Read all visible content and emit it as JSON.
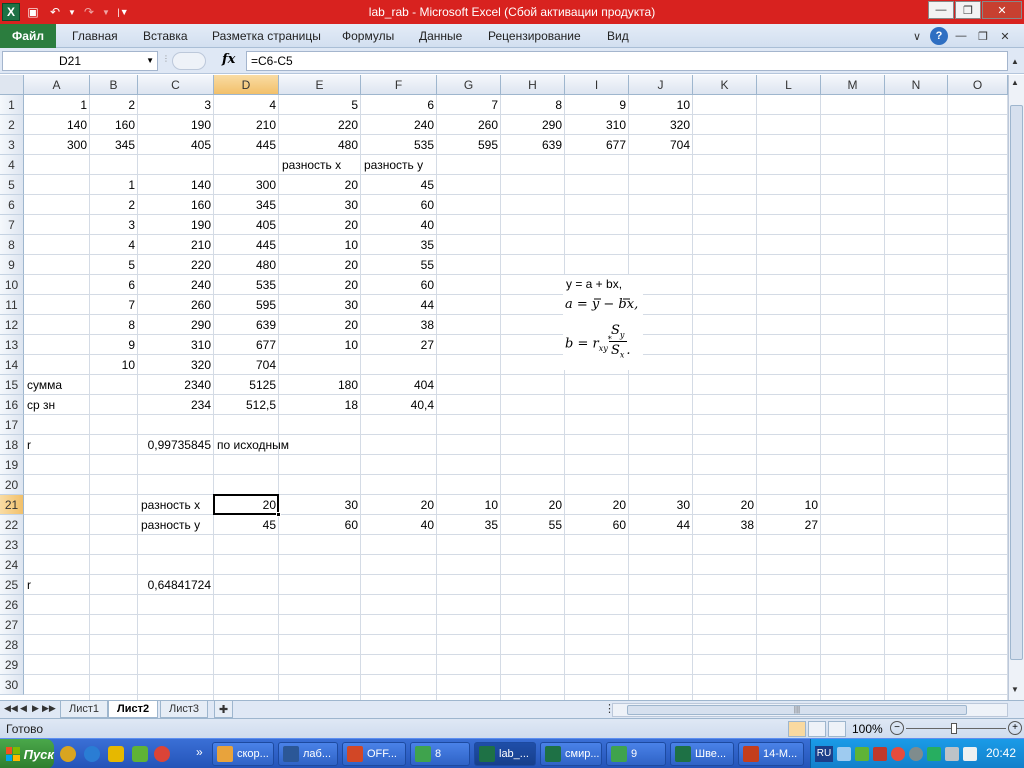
{
  "window": {
    "title": "lab_rab  -  Microsoft Excel (Сбой активации продукта)"
  },
  "ribbon": {
    "file_tab": "Файл",
    "tabs": [
      "Главная",
      "Вставка",
      "Разметка страницы",
      "Формулы",
      "Данные",
      "Рецензирование",
      "Вид"
    ]
  },
  "formula_bar": {
    "name_box": "D21",
    "fx": "fx",
    "formula": "=C6-C5"
  },
  "grid": {
    "columns": [
      "A",
      "B",
      "C",
      "D",
      "E",
      "F",
      "G",
      "H",
      "I",
      "J",
      "K",
      "L",
      "M",
      "N",
      "O"
    ],
    "rows": [
      "1",
      "2",
      "3",
      "4",
      "5",
      "6",
      "7",
      "8",
      "9",
      "10",
      "11",
      "12",
      "13",
      "14",
      "15",
      "16",
      "17",
      "18",
      "19",
      "20",
      "21",
      "22",
      "23",
      "24",
      "25",
      "26",
      "27",
      "28",
      "29",
      "30"
    ],
    "selected_column": "D",
    "selected_row": "21",
    "cells": [
      {
        "ref": "A1",
        "v": "1",
        "t": "n"
      },
      {
        "ref": "B1",
        "v": "2",
        "t": "n"
      },
      {
        "ref": "C1",
        "v": "3",
        "t": "n"
      },
      {
        "ref": "D1",
        "v": "4",
        "t": "n"
      },
      {
        "ref": "E1",
        "v": "5",
        "t": "n"
      },
      {
        "ref": "F1",
        "v": "6",
        "t": "n"
      },
      {
        "ref": "G1",
        "v": "7",
        "t": "n"
      },
      {
        "ref": "H1",
        "v": "8",
        "t": "n"
      },
      {
        "ref": "I1",
        "v": "9",
        "t": "n"
      },
      {
        "ref": "J1",
        "v": "10",
        "t": "n"
      },
      {
        "ref": "A2",
        "v": "140",
        "t": "n"
      },
      {
        "ref": "B2",
        "v": "160",
        "t": "n"
      },
      {
        "ref": "C2",
        "v": "190",
        "t": "n"
      },
      {
        "ref": "D2",
        "v": "210",
        "t": "n"
      },
      {
        "ref": "E2",
        "v": "220",
        "t": "n"
      },
      {
        "ref": "F2",
        "v": "240",
        "t": "n"
      },
      {
        "ref": "G2",
        "v": "260",
        "t": "n"
      },
      {
        "ref": "H2",
        "v": "290",
        "t": "n"
      },
      {
        "ref": "I2",
        "v": "310",
        "t": "n"
      },
      {
        "ref": "J2",
        "v": "320",
        "t": "n"
      },
      {
        "ref": "A3",
        "v": "300",
        "t": "n"
      },
      {
        "ref": "B3",
        "v": "345",
        "t": "n"
      },
      {
        "ref": "C3",
        "v": "405",
        "t": "n"
      },
      {
        "ref": "D3",
        "v": "445",
        "t": "n"
      },
      {
        "ref": "E3",
        "v": "480",
        "t": "n"
      },
      {
        "ref": "F3",
        "v": "535",
        "t": "n"
      },
      {
        "ref": "G3",
        "v": "595",
        "t": "n"
      },
      {
        "ref": "H3",
        "v": "639",
        "t": "n"
      },
      {
        "ref": "I3",
        "v": "677",
        "t": "n"
      },
      {
        "ref": "J3",
        "v": "704",
        "t": "n"
      },
      {
        "ref": "E4",
        "v": "разность x",
        "t": "s"
      },
      {
        "ref": "F4",
        "v": "разность y",
        "t": "s"
      },
      {
        "ref": "B5",
        "v": "1",
        "t": "n"
      },
      {
        "ref": "C5",
        "v": "140",
        "t": "n"
      },
      {
        "ref": "D5",
        "v": "300",
        "t": "n"
      },
      {
        "ref": "E5",
        "v": "20",
        "t": "n"
      },
      {
        "ref": "F5",
        "v": "45",
        "t": "n"
      },
      {
        "ref": "B6",
        "v": "2",
        "t": "n"
      },
      {
        "ref": "C6",
        "v": "160",
        "t": "n"
      },
      {
        "ref": "D6",
        "v": "345",
        "t": "n"
      },
      {
        "ref": "E6",
        "v": "30",
        "t": "n"
      },
      {
        "ref": "F6",
        "v": "60",
        "t": "n"
      },
      {
        "ref": "B7",
        "v": "3",
        "t": "n"
      },
      {
        "ref": "C7",
        "v": "190",
        "t": "n"
      },
      {
        "ref": "D7",
        "v": "405",
        "t": "n"
      },
      {
        "ref": "E7",
        "v": "20",
        "t": "n"
      },
      {
        "ref": "F7",
        "v": "40",
        "t": "n"
      },
      {
        "ref": "B8",
        "v": "4",
        "t": "n"
      },
      {
        "ref": "C8",
        "v": "210",
        "t": "n"
      },
      {
        "ref": "D8",
        "v": "445",
        "t": "n"
      },
      {
        "ref": "E8",
        "v": "10",
        "t": "n"
      },
      {
        "ref": "F8",
        "v": "35",
        "t": "n"
      },
      {
        "ref": "B9",
        "v": "5",
        "t": "n"
      },
      {
        "ref": "C9",
        "v": "220",
        "t": "n"
      },
      {
        "ref": "D9",
        "v": "480",
        "t": "n"
      },
      {
        "ref": "E9",
        "v": "20",
        "t": "n"
      },
      {
        "ref": "F9",
        "v": "55",
        "t": "n"
      },
      {
        "ref": "B10",
        "v": "6",
        "t": "n"
      },
      {
        "ref": "C10",
        "v": "240",
        "t": "n"
      },
      {
        "ref": "D10",
        "v": "535",
        "t": "n"
      },
      {
        "ref": "E10",
        "v": "20",
        "t": "n"
      },
      {
        "ref": "F10",
        "v": "60",
        "t": "n"
      },
      {
        "ref": "B11",
        "v": "7",
        "t": "n"
      },
      {
        "ref": "C11",
        "v": "260",
        "t": "n"
      },
      {
        "ref": "D11",
        "v": "595",
        "t": "n"
      },
      {
        "ref": "E11",
        "v": "30",
        "t": "n"
      },
      {
        "ref": "F11",
        "v": "44",
        "t": "n"
      },
      {
        "ref": "B12",
        "v": "8",
        "t": "n"
      },
      {
        "ref": "C12",
        "v": "290",
        "t": "n"
      },
      {
        "ref": "D12",
        "v": "639",
        "t": "n"
      },
      {
        "ref": "E12",
        "v": "20",
        "t": "n"
      },
      {
        "ref": "F12",
        "v": "38",
        "t": "n"
      },
      {
        "ref": "B13",
        "v": "9",
        "t": "n"
      },
      {
        "ref": "C13",
        "v": "310",
        "t": "n"
      },
      {
        "ref": "D13",
        "v": "677",
        "t": "n"
      },
      {
        "ref": "E13",
        "v": "10",
        "t": "n"
      },
      {
        "ref": "F13",
        "v": "27",
        "t": "n"
      },
      {
        "ref": "B14",
        "v": "10",
        "t": "n"
      },
      {
        "ref": "C14",
        "v": "320",
        "t": "n"
      },
      {
        "ref": "D14",
        "v": "704",
        "t": "n"
      },
      {
        "ref": "A15",
        "v": "сумма",
        "t": "s"
      },
      {
        "ref": "C15",
        "v": "2340",
        "t": "n"
      },
      {
        "ref": "D15",
        "v": "5125",
        "t": "n"
      },
      {
        "ref": "E15",
        "v": "180",
        "t": "n"
      },
      {
        "ref": "F15",
        "v": "404",
        "t": "n"
      },
      {
        "ref": "A16",
        "v": "ср зн",
        "t": "s"
      },
      {
        "ref": "C16",
        "v": "234",
        "t": "n"
      },
      {
        "ref": "D16",
        "v": "512,5",
        "t": "n"
      },
      {
        "ref": "E16",
        "v": "18",
        "t": "n"
      },
      {
        "ref": "F16",
        "v": "40,4",
        "t": "n"
      },
      {
        "ref": "A18",
        "v": "r",
        "t": "s"
      },
      {
        "ref": "C18",
        "v": "0,99735845",
        "t": "n"
      },
      {
        "ref": "D18",
        "v": "по исходным",
        "t": "s"
      },
      {
        "ref": "C21",
        "v": "разность x",
        "t": "s"
      },
      {
        "ref": "D21",
        "v": "20",
        "t": "n"
      },
      {
        "ref": "E21",
        "v": "30",
        "t": "n"
      },
      {
        "ref": "F21",
        "v": "20",
        "t": "n"
      },
      {
        "ref": "G21",
        "v": "10",
        "t": "n"
      },
      {
        "ref": "H21",
        "v": "20",
        "t": "n"
      },
      {
        "ref": "I21",
        "v": "20",
        "t": "n"
      },
      {
        "ref": "J21",
        "v": "30",
        "t": "n"
      },
      {
        "ref": "K21",
        "v": "20",
        "t": "n"
      },
      {
        "ref": "L21",
        "v": "10",
        "t": "n"
      },
      {
        "ref": "C22",
        "v": "разность y",
        "t": "s"
      },
      {
        "ref": "D22",
        "v": "45",
        "t": "n"
      },
      {
        "ref": "E22",
        "v": "60",
        "t": "n"
      },
      {
        "ref": "F22",
        "v": "40",
        "t": "n"
      },
      {
        "ref": "G22",
        "v": "35",
        "t": "n"
      },
      {
        "ref": "H22",
        "v": "55",
        "t": "n"
      },
      {
        "ref": "I22",
        "v": "60",
        "t": "n"
      },
      {
        "ref": "J22",
        "v": "44",
        "t": "n"
      },
      {
        "ref": "K22",
        "v": "38",
        "t": "n"
      },
      {
        "ref": "L22",
        "v": "27",
        "t": "n"
      },
      {
        "ref": "A25",
        "v": "r",
        "t": "s"
      },
      {
        "ref": "C25",
        "v": "0,64841724",
        "t": "n"
      }
    ]
  },
  "formula_image": {
    "line1": "y = a + bx,",
    "line2": "a = y − bx,",
    "line3a": "b = r",
    "line3b": "xy",
    "line3c": "*",
    "num": "S",
    "num_sub": "y",
    "den": "S",
    "den_sub": "x",
    "tail": "."
  },
  "sheets": {
    "tabs": [
      "Лист1",
      "Лист2",
      "Лист3"
    ],
    "active": "Лист2"
  },
  "status": {
    "ready": "Готово",
    "zoom": "100%",
    "zoom_level": 1.0
  },
  "taskbar": {
    "start": "Пуск",
    "buttons": [
      {
        "label": "скор...",
        "icon": "chrome-icon",
        "color": "#e8a33c"
      },
      {
        "label": "лаб...",
        "icon": "word-icon",
        "color": "#2b5797"
      },
      {
        "label": "OFF...",
        "icon": "office-icon",
        "color": "#d24726"
      },
      {
        "label": "8",
        "icon": "chat-icon",
        "color": "#3fa34d"
      },
      {
        "label": "lab_...",
        "icon": "excel-icon",
        "color": "#1e7145"
      },
      {
        "label": "смир...",
        "icon": "excel-icon",
        "color": "#1e7145"
      },
      {
        "label": "9",
        "icon": "chat-icon",
        "color": "#3fa34d"
      },
      {
        "label": "Шве...",
        "icon": "excel-icon",
        "color": "#1e7145"
      },
      {
        "label": "14-М...",
        "icon": "powerpoint-icon",
        "color": "#c43e1c"
      }
    ],
    "lang": "RU",
    "clock": "20:42"
  }
}
